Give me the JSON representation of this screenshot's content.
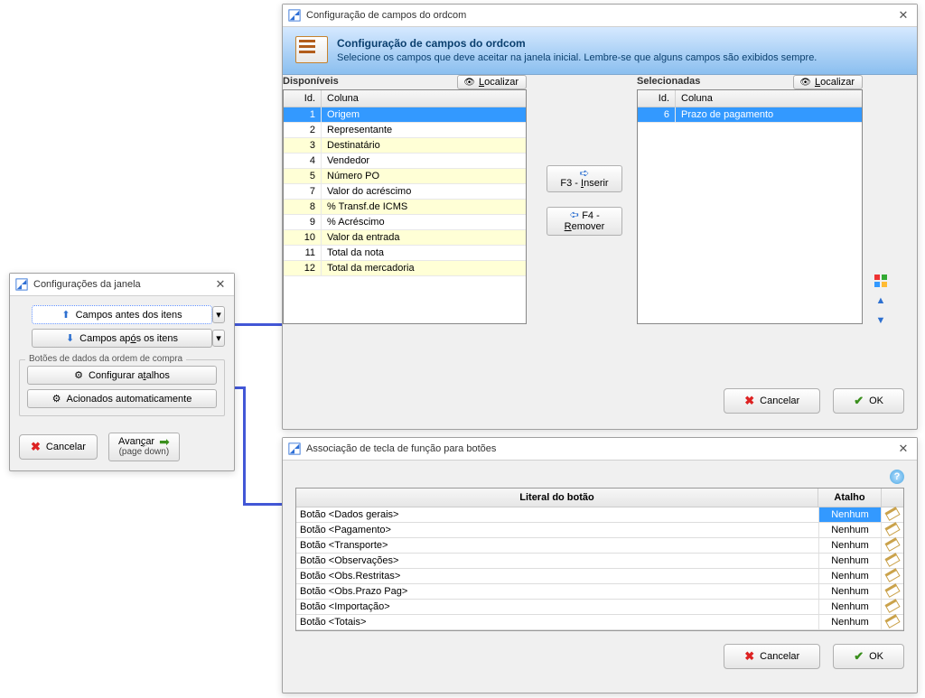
{
  "icons": {
    "close": "✕",
    "arrow_right": "➡",
    "arrow_up_blue": "▲",
    "arrow_down_blue": "▼",
    "drop": "▾"
  },
  "win_cfg": {
    "title": "Configurações da janela",
    "btn_before": "Campos antes dos itens",
    "btn_after": "Campos após os itens",
    "group_label": "Botões de dados da ordem de compra",
    "btn_shortcuts": "Configurar atalhos",
    "btn_auto": "Acionados automaticamente",
    "cancel": "Cancelar",
    "advance_line1": "Avançar",
    "advance_line2": "(page down)"
  },
  "win_fields": {
    "title": "Configuração de campos do ordcom",
    "header_title": "Configuração de campos do ordcom",
    "header_sub": "Selecione os campos que deve aceitar na janela inicial. Lembre-se que alguns campos são exibidos sempre.",
    "available_label": "Disponíveis",
    "selected_label": "Selecionadas",
    "locate": "Localizar",
    "col_id": "Id.",
    "col_name": "Coluna",
    "insert": "F3 - Inserir",
    "remove": "F4 - Remover",
    "cancel": "Cancelar",
    "ok": "OK",
    "available": [
      {
        "id": 1,
        "name": "Origem"
      },
      {
        "id": 2,
        "name": "Representante"
      },
      {
        "id": 3,
        "name": "Destinatário"
      },
      {
        "id": 4,
        "name": "Vendedor"
      },
      {
        "id": 5,
        "name": "Número PO"
      },
      {
        "id": 7,
        "name": "Valor do acréscimo"
      },
      {
        "id": 8,
        "name": "% Transf.de ICMS"
      },
      {
        "id": 9,
        "name": "% Acréscimo"
      },
      {
        "id": 10,
        "name": "Valor da entrada"
      },
      {
        "id": 11,
        "name": "Total da nota"
      },
      {
        "id": 12,
        "name": "Total da mercadoria"
      }
    ],
    "selected": [
      {
        "id": 6,
        "name": "Prazo de pagamento"
      }
    ]
  },
  "win_hotkeys": {
    "title": "Associação de tecla de função para botões",
    "col_literal": "Literal do botão",
    "col_shortcut": "Atalho",
    "rows": [
      {
        "literal": "Botão <Dados gerais>",
        "shortcut": "Nenhum"
      },
      {
        "literal": "Botão <Pagamento>",
        "shortcut": "Nenhum"
      },
      {
        "literal": "Botão <Transporte>",
        "shortcut": "Nenhum"
      },
      {
        "literal": "Botão <Observações>",
        "shortcut": "Nenhum"
      },
      {
        "literal": "Botão <Obs.Restritas>",
        "shortcut": "Nenhum"
      },
      {
        "literal": "Botão <Obs.Prazo Pag>",
        "shortcut": "Nenhum"
      },
      {
        "literal": "Botão <Importação>",
        "shortcut": "Nenhum"
      },
      {
        "literal": "Botão <Totais>",
        "shortcut": "Nenhum"
      }
    ],
    "cancel": "Cancelar",
    "ok": "OK"
  }
}
